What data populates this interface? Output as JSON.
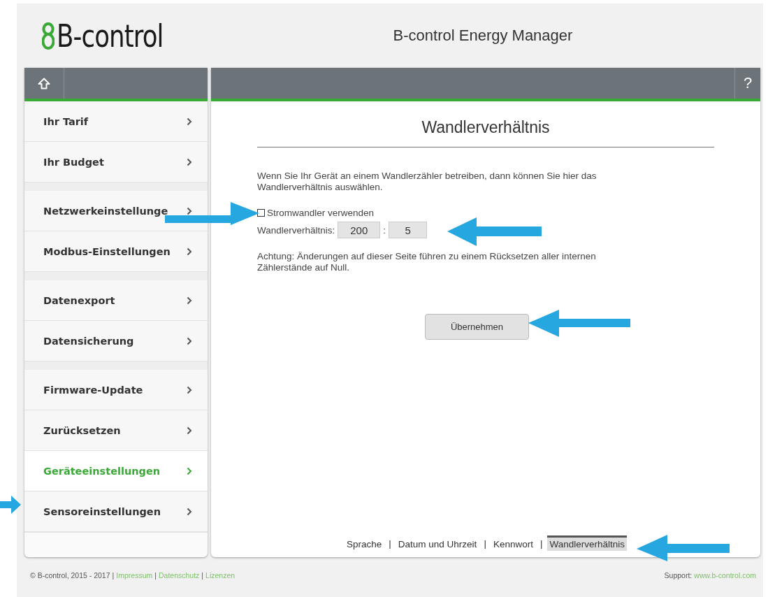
{
  "header": {
    "logo": "B-control",
    "title": "B-control Energy Manager"
  },
  "sidebar": {
    "groups": [
      {
        "items": [
          {
            "label": "Ihr Tarif",
            "selected": false
          },
          {
            "label": "Ihr Budget",
            "selected": false
          }
        ]
      },
      {
        "items": [
          {
            "label": "Netzwerkeinstellunge",
            "selected": false
          },
          {
            "label": "Modbus-Einstellungen",
            "selected": false
          }
        ]
      },
      {
        "items": [
          {
            "label": "Datenexport",
            "selected": false
          },
          {
            "label": "Datensicherung",
            "selected": false
          }
        ]
      },
      {
        "items": [
          {
            "label": "Firmware-Update",
            "selected": false
          },
          {
            "label": "Zurücksetzen",
            "selected": false
          },
          {
            "label": "Geräteeinstellungen",
            "selected": true
          },
          {
            "label": "Sensoreinstellungen",
            "selected": false
          }
        ]
      }
    ]
  },
  "help_button": "?",
  "content": {
    "title": "Wandlerverhältnis",
    "intro": "Wenn Sie Ihr Gerät an einem Wandlerzähler betreiben, dann können Sie hier das Wandlerverhältnis auswählen.",
    "checkbox": {
      "label": "Stromwandler verwenden",
      "checked": false
    },
    "ratio": {
      "label": "Wandlerverhältnis:",
      "primary": "200",
      "separator": ":",
      "secondary": "5"
    },
    "warning": "Achtung: Änderungen auf dieser Seite führen zu einem Rücksetzen aller internen Zählerstände auf Null.",
    "apply_button": "Übernehmen"
  },
  "subnav": [
    {
      "label": "Sprache",
      "selected": false
    },
    {
      "label": "Datum und Uhrzeit",
      "selected": false
    },
    {
      "label": "Kennwort",
      "selected": false
    },
    {
      "label": "Wandlerverhältnis",
      "selected": true
    }
  ],
  "subnav_separator": "|",
  "footer": {
    "copyright": "© B-control, 2015 - 2017",
    "separator": "|",
    "links": [
      "Impressum",
      "Datenschutz",
      "Lizenzen"
    ],
    "support_label": "Support:",
    "support_link": "www.b-control.com"
  }
}
